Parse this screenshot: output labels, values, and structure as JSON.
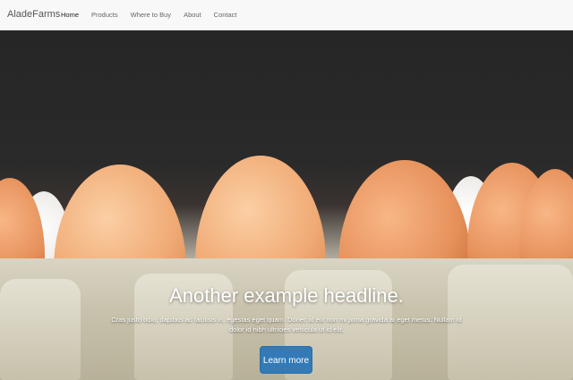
{
  "navbar": {
    "brand": "AladeFarms",
    "items": [
      {
        "label": "Home",
        "active": true
      },
      {
        "label": "Products",
        "active": false
      },
      {
        "label": "Where to Buy",
        "active": false
      },
      {
        "label": "About",
        "active": false
      },
      {
        "label": "Contact",
        "active": false
      }
    ]
  },
  "hero": {
    "headline": "Another example headline.",
    "body": "Cras justo odio, dapibus ac facilisis in, egestas eget quam. Donec id elit non mi porta gravida at eget metus. Nullam id dolor id nibh ultricies vehicula ut id elit.",
    "button_label": "Learn more"
  },
  "colors": {
    "accent": "#337ab7",
    "navbar_bg": "#f8f8f8"
  }
}
